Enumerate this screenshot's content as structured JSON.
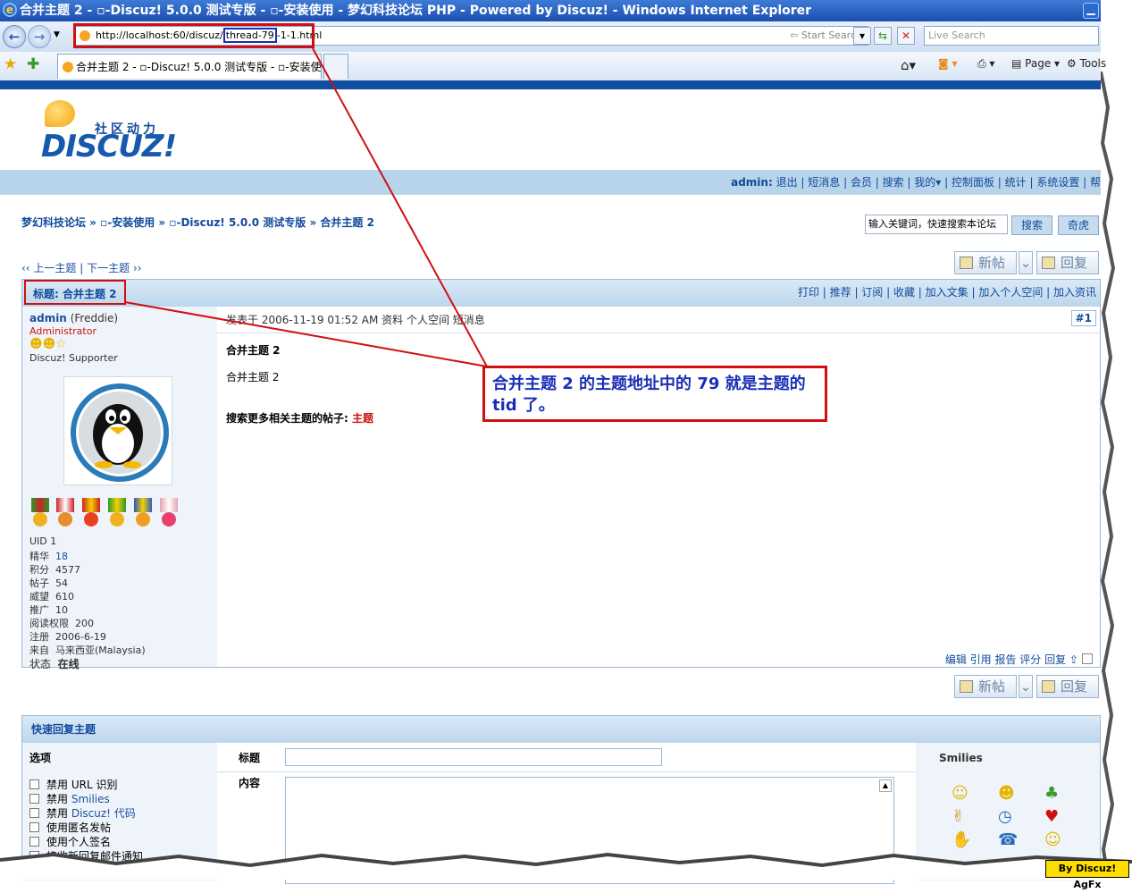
{
  "window": {
    "title": "合并主题 2 - ▫-Discuz! 5.0.0 测试专版 - ▫-安装使用 - 梦幻科技论坛 PHP - Powered by Discuz! - Windows Internet Explorer",
    "min_glyph": "▁"
  },
  "address": {
    "prefix": "http://localhost:60/discuz/",
    "tid": "thread-79",
    "suffix": "-1-1.html",
    "start_search": "Start Search",
    "live_search_placeholder": "Live Search"
  },
  "tab": {
    "label": "合并主题 2 - ▫-Discuz! 5.0.0 测试专版 - ▫-安装使..."
  },
  "toolbar": {
    "page_label": "Page",
    "tools_label": "Tools"
  },
  "logo": {
    "cn": "社区动力",
    "en": "DISCUZ!"
  },
  "header": {
    "user": "admin:",
    "links": "退出 | 短消息 | 会员 | 搜索 | 我的▾ | 控制面板 | 统计 | 系统设置 | 帮"
  },
  "breadcrumb": "梦幻科技论坛 » ▫-安装使用 » ▫-Discuz! 5.0.0 测试专版 » 合并主题 2",
  "search": {
    "placeholder": "输入关键词，快速搜索本论坛",
    "button": "搜索",
    "button2": "奇虎"
  },
  "prevnext": "‹‹ 上一主题 | 下一主题 ››",
  "buttons": {
    "new_post": "新帖",
    "reply": "回复"
  },
  "thread": {
    "subject": "标题: 合并主题 2",
    "links": "打印 | 推荐 | 订阅 | 收藏 | 加入文集 | 加入个人空间 | 加入资讯",
    "post_meta": "发表于 2006-11-19 01:52 AM  资料  个人空间  短消息",
    "floor": "#1",
    "post_title": "合并主题 2",
    "post_body": "合并主题 2",
    "related_label": "搜索更多相关主题的帖子: ",
    "related_keyword": "主题",
    "actions": "编辑  引用  报告  评分  回复  ⇪"
  },
  "user": {
    "name": "admin",
    "nick": "(Freddie)",
    "group": "Administrator",
    "title": "Discuz! Supporter",
    "stats": [
      {
        "label": "UID",
        "value": "1"
      },
      {
        "label": "精华",
        "value": "18"
      },
      {
        "label": "积分",
        "value": "4577"
      },
      {
        "label": "帖子",
        "value": "54"
      },
      {
        "label": "威望",
        "value": "610"
      },
      {
        "label": "推广",
        "value": "10"
      },
      {
        "label": "阅读权限",
        "value": "200"
      },
      {
        "label": "注册",
        "value": "2006-6-19"
      },
      {
        "label": "来自",
        "value": "马来西亚(Malaysia)"
      },
      {
        "label": "状态",
        "value": "在线"
      }
    ]
  },
  "quick_reply": {
    "title": "快速回复主题",
    "options_label": "选项",
    "subject_label": "标题",
    "content_label": "内容",
    "smilies_label": "Smilies",
    "options": [
      {
        "prefix": "禁用 ",
        "hl": "URL",
        "suffix": " 识别"
      },
      {
        "prefix": "禁用 ",
        "hl": "Smilies",
        "suffix": ""
      },
      {
        "prefix": "禁用 ",
        "hl": "Discuz! 代码",
        "suffix": ""
      },
      {
        "prefix": "使用匿名发帖",
        "hl": "",
        "suffix": ""
      },
      {
        "prefix": "使用个人签名",
        "hl": "",
        "suffix": ""
      },
      {
        "prefix": "接收新回复邮件通知",
        "hl": "",
        "suffix": ""
      }
    ]
  },
  "annotation": {
    "callout": "合并主题 2 的主题地址中的 79 就是主题的 tid 了。",
    "credit": "By Discuz! AgFx",
    "color": "#d01010"
  }
}
